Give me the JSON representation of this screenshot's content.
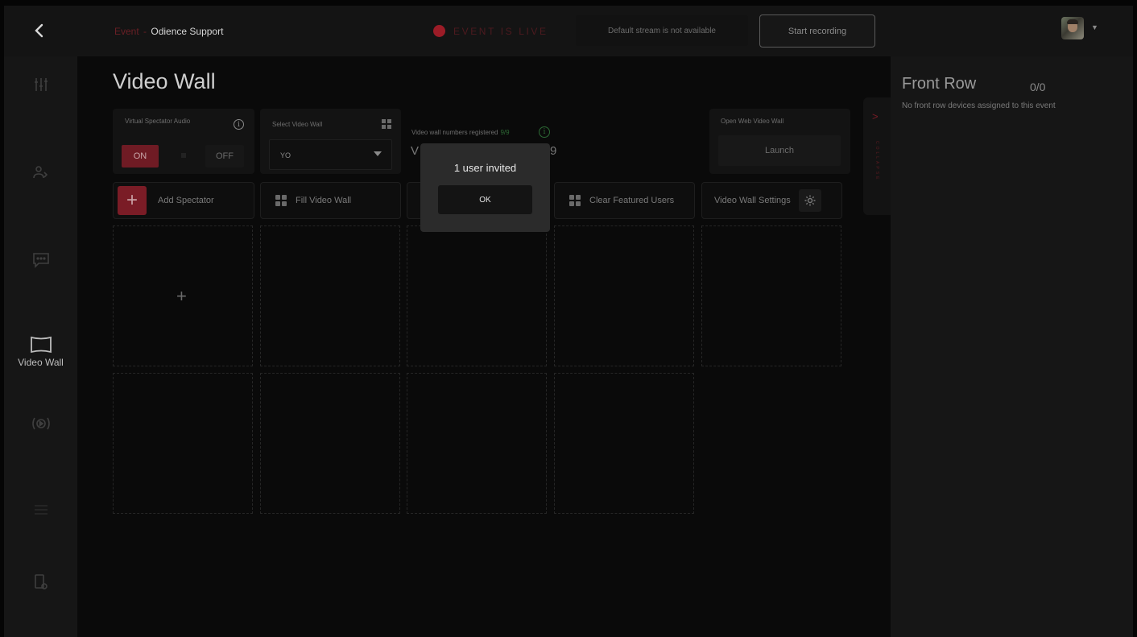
{
  "header": {
    "breadcrumb_event": "Event",
    "breadcrumb_sep": "-",
    "breadcrumb_name": "Odience Support",
    "live_status": "EVENT IS LIVE",
    "stream_status": "Default stream is not available",
    "record_label": "Start recording",
    "live_color": "#9c1c27"
  },
  "sidebar": {
    "items": [
      {
        "icon": "mixer-icon",
        "label": ""
      },
      {
        "icon": "users-icon",
        "label": ""
      },
      {
        "icon": "chat-icon",
        "label": ""
      },
      {
        "icon": "video-wall-icon",
        "label": "Video Wall",
        "active": true
      },
      {
        "icon": "broadcast-icon",
        "label": ""
      },
      {
        "icon": "list-icon",
        "label": ""
      },
      {
        "icon": "device-icon",
        "label": ""
      }
    ]
  },
  "main": {
    "title": "Video Wall",
    "audio_card": {
      "label": "Virtual Spectator Audio",
      "on_label": "ON",
      "off_label": "OFF"
    },
    "select_card": {
      "label": "Select Video Wall",
      "value": "YO"
    },
    "registered": {
      "label": "Video wall numbers registered",
      "value": "9/9",
      "behind_left": "V",
      "behind_right": "9"
    },
    "launch_card": {
      "label": "Open Web Video Wall",
      "button": "Launch"
    },
    "actions": {
      "add_spectator": "Add Spectator",
      "fill_wall": "Fill Video Wall",
      "clear_featured": "Clear Featured Users",
      "settings": "Video Wall Settings"
    },
    "accent_color": "#7a1c26"
  },
  "front_row": {
    "title": "Front Row",
    "count": "0/0",
    "message": "No front row devices assigned to this event",
    "collapse_label": "COLLAPSE"
  },
  "modal": {
    "message": "1 user invited",
    "ok_label": "OK"
  }
}
